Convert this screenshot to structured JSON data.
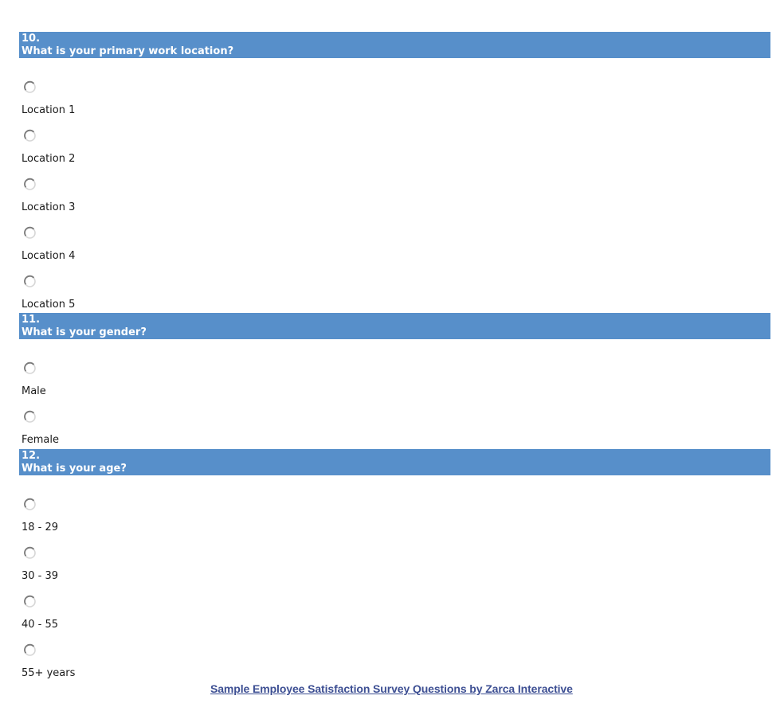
{
  "questions": [
    {
      "number": "10.",
      "text": "What is your primary work location?",
      "options": [
        "Location 1",
        "Location 2",
        "Location 3",
        "Location 4",
        "Location 5"
      ]
    },
    {
      "number": "11.",
      "text": "What is your gender?",
      "options": [
        "Male",
        "Female"
      ]
    },
    {
      "number": "12.",
      "text": "What is your age?",
      "options": [
        "18 - 29",
        "30 - 39",
        "40 - 55",
        "55+ years"
      ]
    }
  ],
  "footer": {
    "link_text": "Sample Employee Satisfaction Survey Questions by Zarca Interactive"
  },
  "colors": {
    "header_bg": "#578fca",
    "header_text": "#ffffff",
    "link": "#3d4f93"
  }
}
